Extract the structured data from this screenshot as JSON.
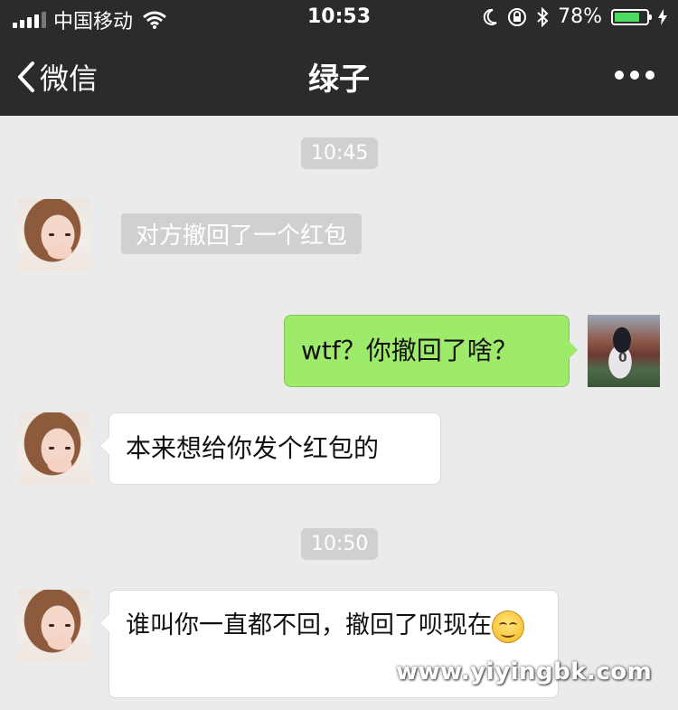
{
  "status_bar": {
    "carrier": "中国移动",
    "time": "10:53",
    "battery_percent": "78%",
    "battery_level": 0.78,
    "icons": [
      "signal-icon",
      "wifi-icon",
      "moon-icon",
      "orientation-lock-icon",
      "bluetooth-icon",
      "battery-icon",
      "charging-icon"
    ]
  },
  "nav": {
    "back_label": "微信",
    "title": "绿子",
    "more_icon": "more-dots-icon"
  },
  "chat": {
    "timestamps": [
      "10:45",
      "10:50"
    ],
    "messages": [
      {
        "from": "other",
        "type": "system",
        "text": "对方撤回了一个红包"
      },
      {
        "from": "me",
        "type": "text",
        "text": "wtf？你撤回了啥？"
      },
      {
        "from": "other",
        "type": "text",
        "text": "本来想给你发个红包的"
      },
      {
        "from": "other",
        "type": "text",
        "text": "谁叫你一直都不回，撤回了呗现在"
      }
    ]
  },
  "watermark": "www.yiyingbk.com",
  "colors": {
    "bar_bg": "#2b2b2d",
    "chat_bg": "#ebebeb",
    "my_bubble": "#9eea6a",
    "their_bubble": "#ffffff",
    "timestamp_bg": "#d0d0d0"
  }
}
